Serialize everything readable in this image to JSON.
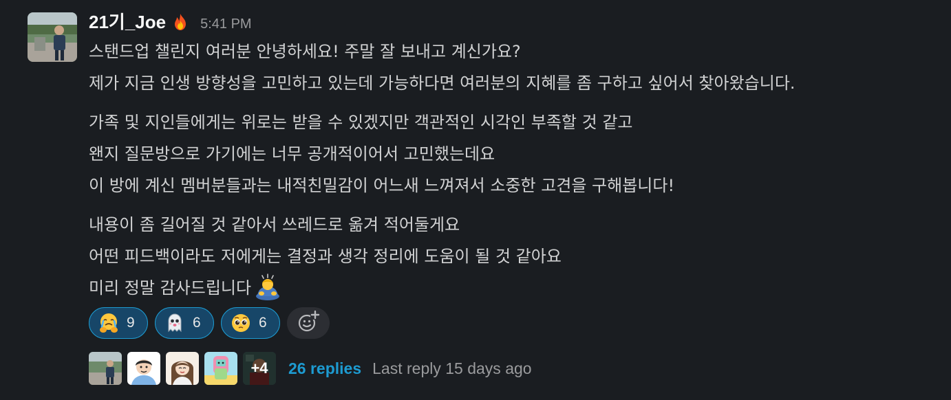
{
  "message": {
    "author": "21기_Joe",
    "author_emoji": "fire-icon",
    "timestamp": "5:41 PM",
    "lines": {
      "l1": "스탠드업 챌린지 여러분 안녕하세요!  주말 잘 보내고 계신가요?",
      "l2": "제가 지금 인생 방향성을 고민하고 있는데 가능하다면 여러분의 지혜를 좀 구하고 싶어서 찾아왔습니다.",
      "l3": "가족 및 지인들에게는 위로는 받을 수 있겠지만 객관적인 시각인 부족할 것 같고",
      "l4": "왠지 질문방으로 가기에는 너무 공개적이어서 고민했는데요",
      "l5": "이 방에 계신 멤버분들과는 내적친밀감이 어느새 느껴져서 소중한 고견을 구해봅니다!",
      "l6": "내용이 좀 길어질 것 같아서 쓰레드로 옮겨 적어둘게요",
      "l7": "어떤 피드백이라도 저에게는 결정과 생각 정리에 도움이 될 것 같아요",
      "l8": "미리 정말 감사드립니다"
    },
    "closing_emoji": "bowing-person-icon"
  },
  "reactions": [
    {
      "emoji": "crying-hugging-face-icon",
      "count": "9"
    },
    {
      "emoji": "ghost-face-icon",
      "count": "6"
    },
    {
      "emoji": "pleading-face-icon",
      "count": "6"
    }
  ],
  "add_reaction_icon": "add-reaction-icon",
  "thread": {
    "more_count": "+4",
    "replies": "26 replies",
    "last_reply": "Last reply 15 days ago"
  },
  "colors": {
    "background": "#1a1d21",
    "text": "#d1d2d3",
    "author": "#f8f8f8",
    "muted": "#9a9b9d",
    "link": "#1d9bd1",
    "reaction_bg": "#174668",
    "reaction_border": "#1d9bd1"
  }
}
